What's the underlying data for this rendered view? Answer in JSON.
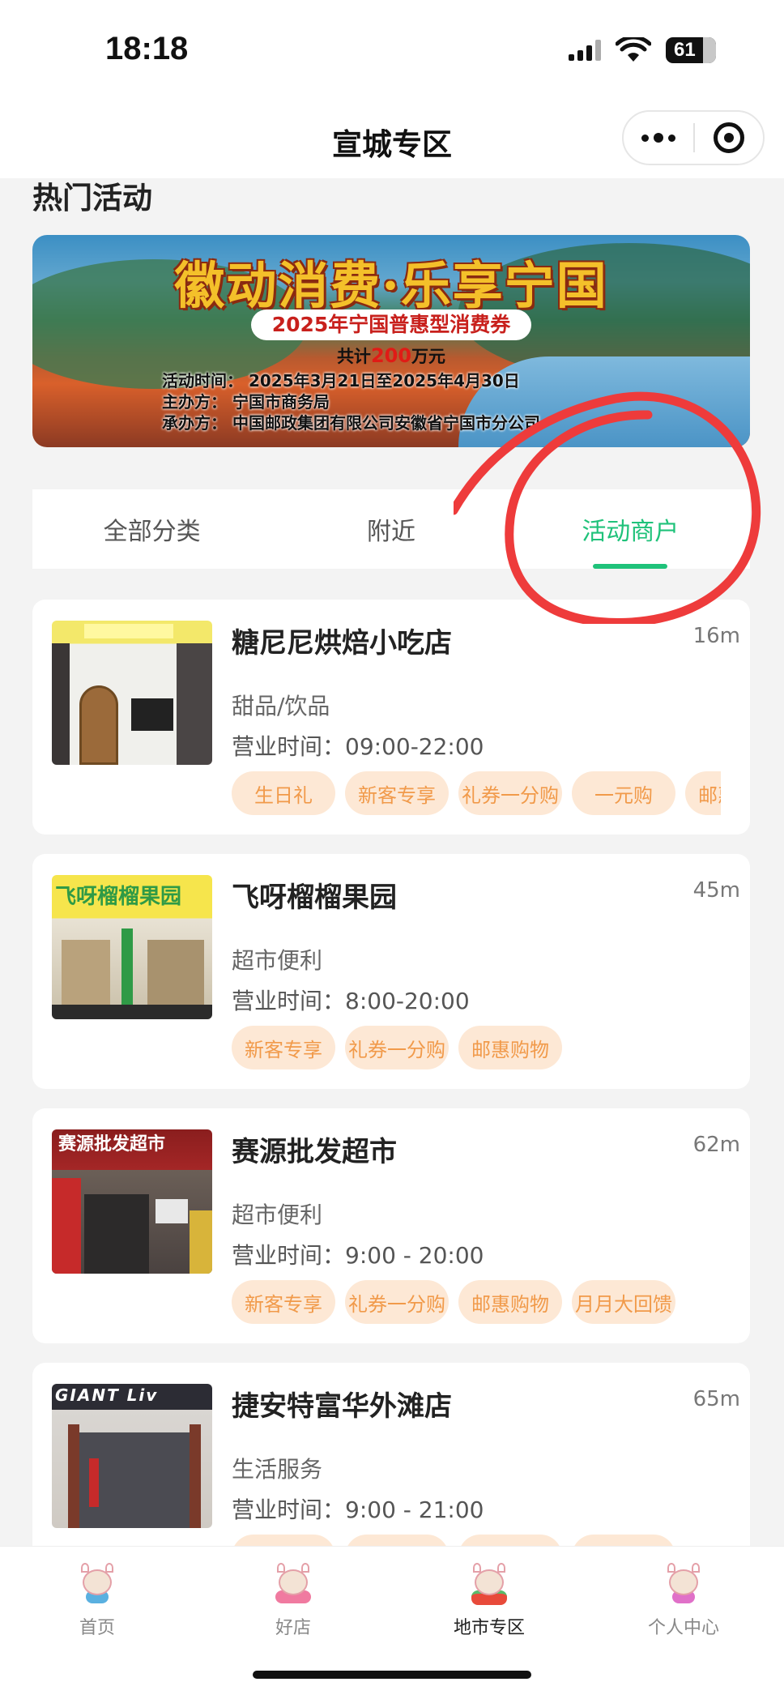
{
  "status_bar": {
    "time": "18:18",
    "battery": "61"
  },
  "nav": {
    "title": "宣城专区"
  },
  "section_title": "热门活动",
  "banner": {
    "title": "徽动消费·乐享宁国",
    "subtitle": "2025年宁国普惠型消费券",
    "total_prefix": "共计",
    "total_amount": "200",
    "total_suffix": "万元",
    "time_line": "活动时间：  2025年3月21日至2025年4月30日",
    "organizer_line": "主办方：  宁国市商务局",
    "undertaker_line": "承办方：  中国邮政集团有限公司安徽省宁国市分公司"
  },
  "tabs": [
    {
      "label": "全部分类",
      "active": false
    },
    {
      "label": "附近",
      "active": false
    },
    {
      "label": "活动商户",
      "active": true
    }
  ],
  "merchants": [
    {
      "name": "糖尼尼烘焙小吃店",
      "distance": "16m",
      "category": "甜品/饮品",
      "hours": "营业时间：09:00-22:00",
      "tags": [
        "生日礼",
        "新客专享",
        "礼券一分购",
        "一元购",
        "邮惠购物"
      ]
    },
    {
      "name": "飞呀榴榴果园",
      "distance": "45m",
      "category": "超市便利",
      "hours": "营业时间：8:00-20:00",
      "photo_sign": "飞呀榴榴果园",
      "tags": [
        "新客专享",
        "礼券一分购",
        "邮惠购物"
      ]
    },
    {
      "name": "赛源批发超市",
      "distance": "62m",
      "category": "超市便利",
      "hours": "营业时间：9:00 - 20:00",
      "photo_sign": "赛源批发超市",
      "tags": [
        "新客专享",
        "礼券一分购",
        "邮惠购物",
        "月月大回馈"
      ]
    },
    {
      "name": "捷安特富华外滩店",
      "distance": "65m",
      "category": "生活服务",
      "hours": "营业时间：9:00 - 21:00",
      "photo_sign": "GIANT   Liv"
    }
  ],
  "tabbar": [
    {
      "label": "首页",
      "icon": "mascot-home-icon",
      "active": false
    },
    {
      "label": "好店",
      "icon": "mascot-shop-icon",
      "active": false
    },
    {
      "label": "地市专区",
      "icon": "mascot-city-icon",
      "active": true
    },
    {
      "label": "个人中心",
      "icon": "mascot-profile-icon",
      "active": false
    }
  ],
  "colors": {
    "accent_green": "#1fc27a",
    "tag_bg": "#fde8d5",
    "tag_text": "#f19a4a",
    "annotation_red": "#ee3b3b",
    "banner_title": "#f4c02a"
  }
}
